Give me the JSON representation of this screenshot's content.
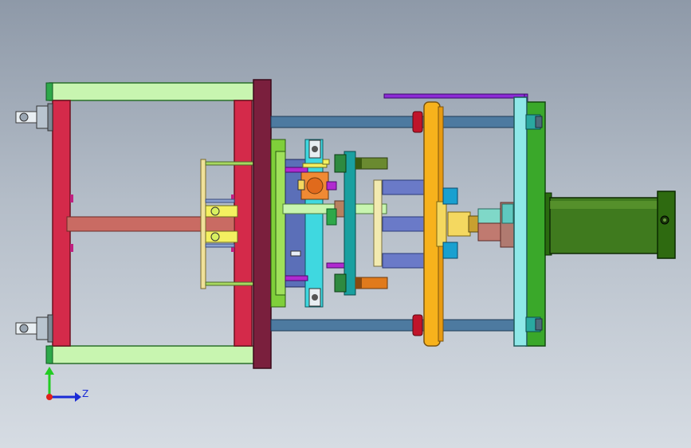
{
  "viewport": {
    "background_top": "#8e99a8",
    "background_bottom": "#d6dce3"
  },
  "triad": {
    "axis_label": "Z",
    "y_color": "#22cc22",
    "z_color": "#1a2bd6",
    "origin_color": "#e0201a"
  },
  "palette": {
    "frame_red": "#d42a4a",
    "frame_green": "#c8f5b0",
    "plate_maroon": "#7a1f3d",
    "plate_green": "#7fcf3a",
    "plate_cyan": "#8fe8e8",
    "plate_orange": "#f7b21c",
    "rod_blue": "#4d7aa0",
    "cylinder_green": "#3f7a1e",
    "bar_brown": "#c96b63",
    "purple_strip": "#8c2bd6"
  }
}
